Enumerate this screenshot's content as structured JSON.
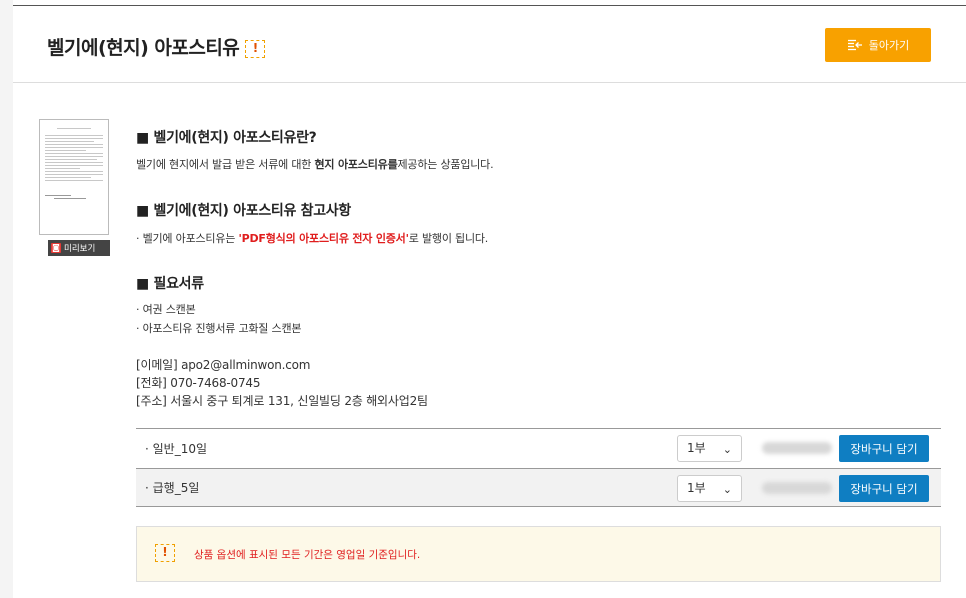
{
  "header": {
    "title": "벨기에(현지) 아포스티유",
    "warn_glyph": "!",
    "back_label": "돌아가기"
  },
  "preview_label": "미리보기",
  "section1": {
    "title": "■ 벨기에(현지) 아포스티유란?",
    "text_pre": "벨기에 현지에서 발급 받은 서류에 대한 ",
    "text_bold": "현지 아포스티유를",
    "text_post": "제공하는 상품입니다."
  },
  "section2": {
    "title": "■ 벨기에(현지) 아포스티유 참고사항",
    "text_pre": "· 벨기에 아포스티유는 ",
    "text_red": "'PDF형식의 아포스티유 전자 인증서'",
    "text_post": "로 발행이 됩니다."
  },
  "section3": {
    "title": "■ 필요서류",
    "items": [
      "· 여권 스캔본",
      "· 아포스티유 진행서류 고화질 스캔본"
    ]
  },
  "contact": {
    "email": "[이메일] apo2@allminwon.com",
    "phone": "[전화] 070-7468-0745",
    "address": "[주소] 서울시 중구 퇴계로 131, 신일빌딩 2층 해외사업2팀"
  },
  "options": [
    {
      "label": "· 일반_10일",
      "qty": "1부",
      "cart": "장바구니 담기"
    },
    {
      "label": "· 급행_5일",
      "qty": "1부",
      "cart": "장바구니 담기"
    }
  ],
  "notice": {
    "text": "상품 옵션에 표시된 모든 기간은 영업일 기준입니다."
  },
  "colors": {
    "accent": "#f8a100",
    "cart": "#0f7ec2",
    "alert": "#e01e1e"
  }
}
